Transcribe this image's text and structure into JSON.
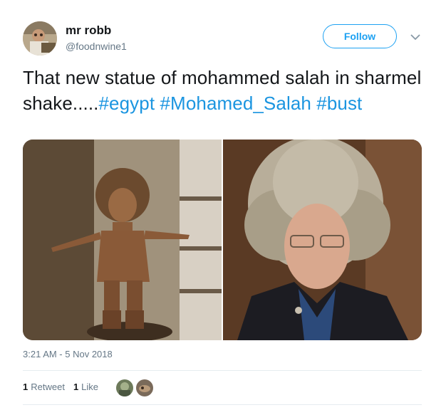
{
  "author": {
    "name": "mr robb",
    "handle": "@foodnwine1"
  },
  "follow_label": "Follow",
  "tweet": {
    "text": "That new statue of mohammed salah in sharmel shake.....",
    "hashtags": [
      "#egypt",
      "#Mohamed_Salah",
      "#bust"
    ]
  },
  "timestamp": "3:21 AM - 5 Nov 2018",
  "stats": {
    "retweet_count": "1",
    "retweet_label": "Retweet",
    "like_count": "1",
    "like_label": "Like"
  },
  "colors": {
    "accent": "#1da1f2",
    "hashtag": "#1b95e0",
    "secondary_text": "#657786"
  }
}
